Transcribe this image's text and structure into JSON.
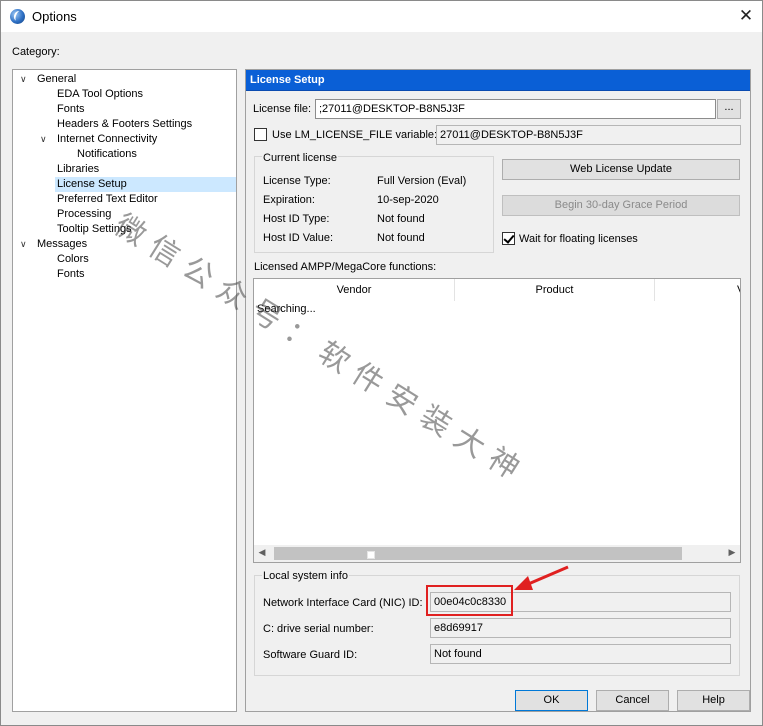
{
  "window": {
    "title": "Options",
    "close_glyph": "✕",
    "app_icon": "globe-icon"
  },
  "category_label": "Category:",
  "tree": [
    {
      "label": "General",
      "expanded": true
    },
    {
      "label": "EDA Tool Options"
    },
    {
      "label": "Fonts"
    },
    {
      "label": "Headers & Footers Settings"
    },
    {
      "label": "Internet Connectivity",
      "expanded": true
    },
    {
      "label": "Notifications"
    },
    {
      "label": "Libraries"
    },
    {
      "label": "License Setup",
      "selected": true
    },
    {
      "label": "Preferred Text Editor"
    },
    {
      "label": "Processing"
    },
    {
      "label": "Tooltip Settings"
    },
    {
      "label": "Messages",
      "expanded": true
    },
    {
      "label": "Colors"
    },
    {
      "label": "Fonts"
    }
  ],
  "panel": {
    "header": "License Setup",
    "license_file_label": "License file:",
    "license_file_value": ";27011@DESKTOP-B8N5J3F",
    "browse_label": "...",
    "use_env_label": "Use LM_LICENSE_FILE variable:",
    "use_env_checked": false,
    "env_value": "27011@DESKTOP-B8N5J3F",
    "current_license": {
      "title": "Current license",
      "rows": [
        {
          "label": "License Type:",
          "value": "Full Version (Eval)"
        },
        {
          "label": "Expiration:",
          "value": "10-sep-2020"
        },
        {
          "label": "Host ID Type:",
          "value": "Not found"
        },
        {
          "label": "Host ID Value:",
          "value": "Not found"
        }
      ]
    },
    "web_license_update_label": "Web License Update",
    "grace_period_label": "Begin 30-day Grace Period",
    "wait_floating_label": "Wait for floating licenses",
    "wait_floating_checked": true,
    "functions_label": "Licensed AMPP/MegaCore functions:",
    "columns": [
      "Vendor",
      "Product",
      "V"
    ],
    "searching_text": "Searching...",
    "scroll_left": "◀",
    "scroll_right": "▶",
    "local_info": {
      "title": "Local system info",
      "rows": [
        {
          "label": "Network Interface Card (NIC) ID:",
          "value": "00e04c0c8330"
        },
        {
          "label": "C: drive serial number:",
          "value": "e8d69917"
        },
        {
          "label": "Software Guard ID:",
          "value": "Not found"
        }
      ]
    }
  },
  "buttons": {
    "ok": "OK",
    "cancel": "Cancel",
    "help": "Help"
  },
  "annotation": {
    "color": "#e02020"
  },
  "watermark": "微信公众号：软件安装大神",
  "colors": {
    "header_blue": "#0a5fd6",
    "selection": "#cce8ff"
  }
}
